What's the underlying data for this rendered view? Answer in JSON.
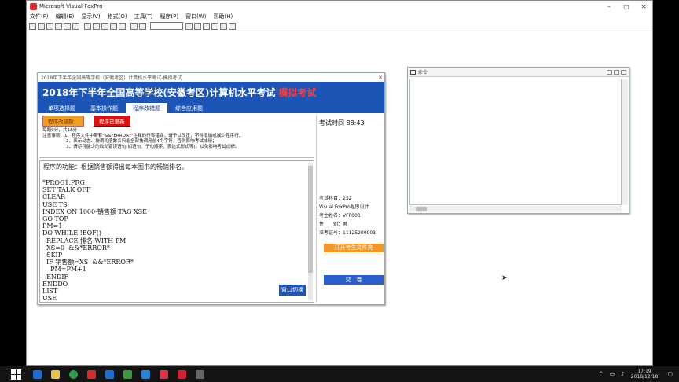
{
  "vfp": {
    "title": "Microsoft Visual FoxPro",
    "menu": [
      "文件(F)",
      "编辑(E)",
      "显示(V)",
      "格式(O)",
      "工具(T)",
      "程序(P)",
      "窗口(W)",
      "帮助(H)"
    ],
    "win_min": "–",
    "win_max": "□",
    "win_close": "✕"
  },
  "exam": {
    "caption": "2018年下半年全国高等学校（安徽考区）计算机水平考试-模拟考试",
    "title": "2018年下半年全国高等学校(安徽考区)计算机水平考试",
    "mock": "模拟考试",
    "tabs": [
      {
        "label": "单项选择题",
        "active": false
      },
      {
        "label": "基本操作题",
        "active": false
      },
      {
        "label": "程序改错题",
        "active": true
      },
      {
        "label": "综合应用题",
        "active": false
      }
    ],
    "buttons": {
      "start_fix": "程序改错题：",
      "red_button": "程序已更新"
    },
    "notice": {
      "line1": "每题9分，共18分",
      "line2": "注意事项：1、程序文件中带有\"&&*ERROR*\"注释的行有错误，请予以改正，不得增加或减少程序行；",
      "line3": "2、表示动态、被调初函数名只能全部被调用前4个字符，否则影响考试成绩；",
      "line4": "3、请尽可能少的改动错误语句(如语句、子句顺序、表达式形式等)，以免影响考试成绩。"
    },
    "function_desc": "程序的功能：根据销售额得出每本图书的畅销排名。",
    "code_lines": [
      "*PROG1.PRG",
      "SET TALK OFF",
      "CLEAR",
      "USE TS",
      "INDEX ON 1000-销售额 TAG XSE",
      "GO TOP",
      "PM=1",
      "DO WHILE !EOF()",
      "  REPLACE 排名 WITH PM",
      "  XS=0  &&*ERROR*",
      "  SKIP",
      "  IF 销售额=XS  &&*ERROR*",
      "    PM=PM+1",
      "  ENDIF",
      "ENDDO",
      "LIST",
      "USE"
    ],
    "switch_label": "窗口切换",
    "time_label": "考试时间 88:43",
    "info": {
      "subject": "考试科目：252",
      "course": "Visual FoxPro程序设计",
      "name": "考生姓名：VFP003",
      "gender": "性　　别：男",
      "ticket": "准考证号：11125200003"
    },
    "open_folder": "打开考生文件夹",
    "submit": "交　卷"
  },
  "side": {
    "caption": "命令"
  },
  "taskbar": {
    "time": "17:19",
    "date": "2018/12/18"
  }
}
